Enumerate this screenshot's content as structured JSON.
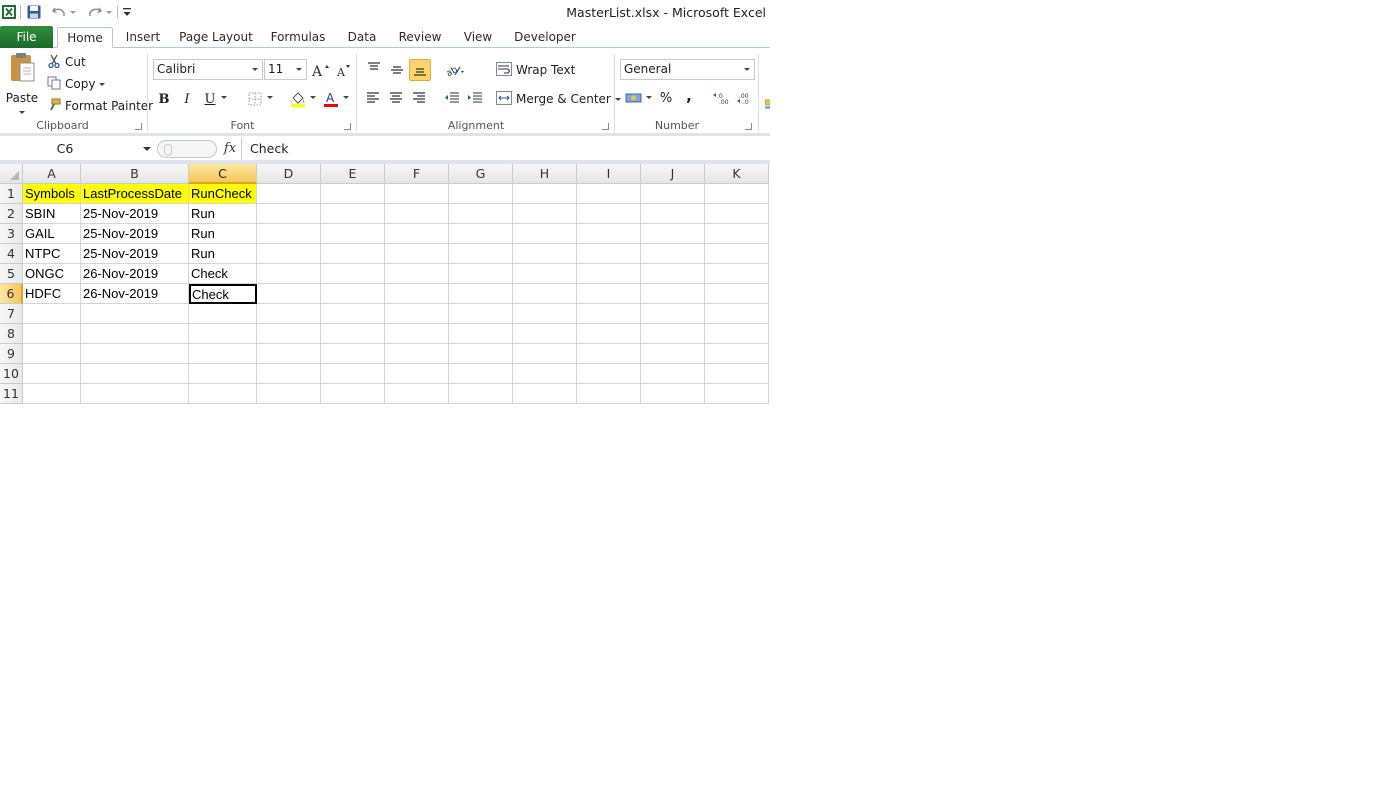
{
  "window": {
    "title": "MasterList.xlsx  -  Microsoft Excel"
  },
  "tabs": [
    {
      "label": "File"
    },
    {
      "label": "Home"
    },
    {
      "label": "Insert"
    },
    {
      "label": "Page Layout"
    },
    {
      "label": "Formulas"
    },
    {
      "label": "Data"
    },
    {
      "label": "Review"
    },
    {
      "label": "View"
    },
    {
      "label": "Developer"
    }
  ],
  "clipboard": {
    "paste": "Paste",
    "cut": "Cut",
    "copy": "Copy",
    "format_painter": "Format Painter",
    "label": "Clipboard"
  },
  "font": {
    "name": "Calibri",
    "size": "11",
    "bold": "B",
    "italic": "I",
    "underline": "U",
    "label": "Font",
    "fill_color": "#ffff00",
    "font_color": "#ff0000"
  },
  "alignment": {
    "wrap_text": "Wrap Text",
    "merge_center": "Merge & Center",
    "label": "Alignment"
  },
  "number": {
    "format": "General",
    "percent": "%",
    "comma": ",",
    "label": "Number"
  },
  "formula_bar": {
    "name_box": "C6",
    "fx": "fx",
    "content": "Check"
  },
  "sheet": {
    "columns": [
      "A",
      "B",
      "C",
      "D",
      "E",
      "F",
      "G",
      "H",
      "I",
      "J",
      "K"
    ],
    "rows": [
      "1",
      "2",
      "3",
      "4",
      "5",
      "6",
      "7",
      "8",
      "9",
      "10",
      "11"
    ],
    "selected_column": "C",
    "selected_row": "6",
    "header_fill": "#ffff00",
    "cells": [
      [
        "Symbols",
        "LastProcessDate",
        "RunCheck"
      ],
      [
        "SBIN",
        "25-Nov-2019",
        "Run"
      ],
      [
        "GAIL",
        "25-Nov-2019",
        "Run"
      ],
      [
        "NTPC",
        "25-Nov-2019",
        "Run"
      ],
      [
        "ONGC",
        "26-Nov-2019",
        "Check"
      ],
      [
        "HDFC",
        "26-Nov-2019",
        "Check"
      ]
    ]
  }
}
